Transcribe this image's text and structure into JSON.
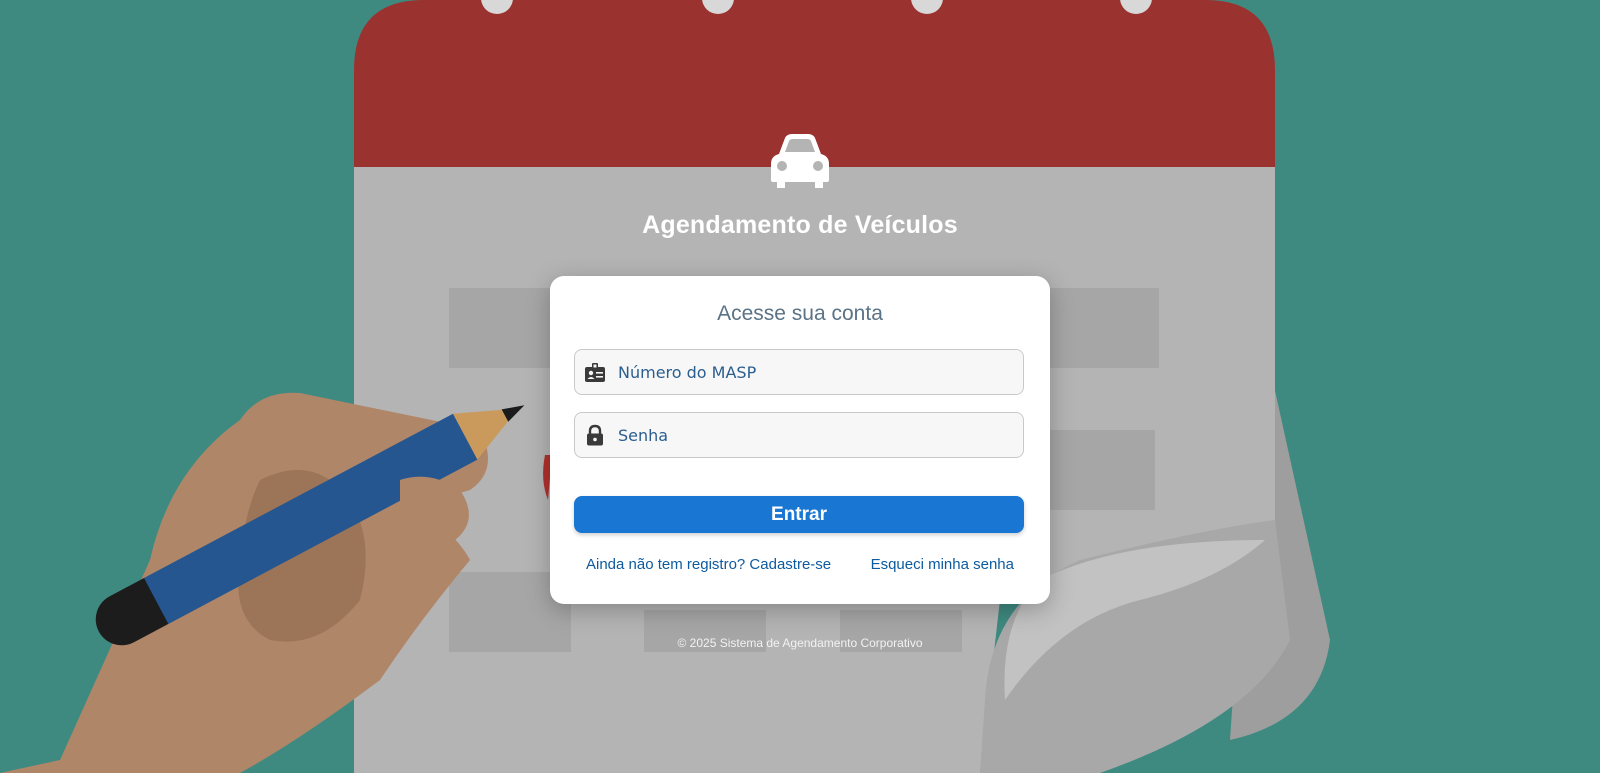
{
  "app": {
    "title": "Agendamento de Veículos",
    "icon": "car-icon"
  },
  "login": {
    "heading": "Acesse sua conta",
    "masp": {
      "placeholder": "Número do MASP",
      "value": "",
      "icon": "id-badge-icon"
    },
    "senha": {
      "placeholder": "Senha",
      "value": "",
      "icon": "lock-icon"
    },
    "submit_label": "Entrar",
    "register_link": "Ainda não tem registro? Cadastre-se",
    "forgot_link": "Esqueci minha senha"
  },
  "footer": {
    "copyright": "© 2025 Sistema de Agendamento Corporativo"
  },
  "colors": {
    "background": "#3f8a80",
    "calendar_header": "#9a3330",
    "calendar_body": "#b4b4b4",
    "primary_button": "#1976d2",
    "link": "#0d5a9e",
    "card_heading": "#5a7386"
  }
}
